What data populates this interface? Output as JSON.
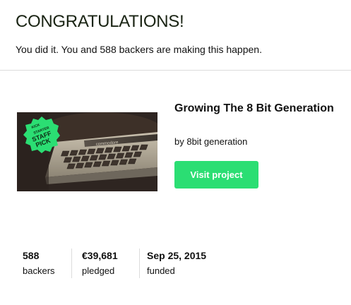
{
  "header": {
    "title": "CONGRATULATIONS!",
    "message": "You did it. You and 588 backers are making this happen."
  },
  "project": {
    "title": "Growing The 8 Bit Generation",
    "creator": "by 8bit generation",
    "visit_label": "Visit project",
    "badge": {
      "line1": "KICK",
      "line2": "STARTER",
      "line3": "STAFF",
      "line4": "PICK"
    },
    "image_brand_text": "commodore",
    "accent_color": "#2bde73"
  },
  "stats": {
    "backers_value": "588",
    "backers_label": "backers",
    "pledged_value": "€39,681",
    "pledged_label": "pledged",
    "funded_value": "Sep 25, 2015",
    "funded_label": "funded"
  }
}
